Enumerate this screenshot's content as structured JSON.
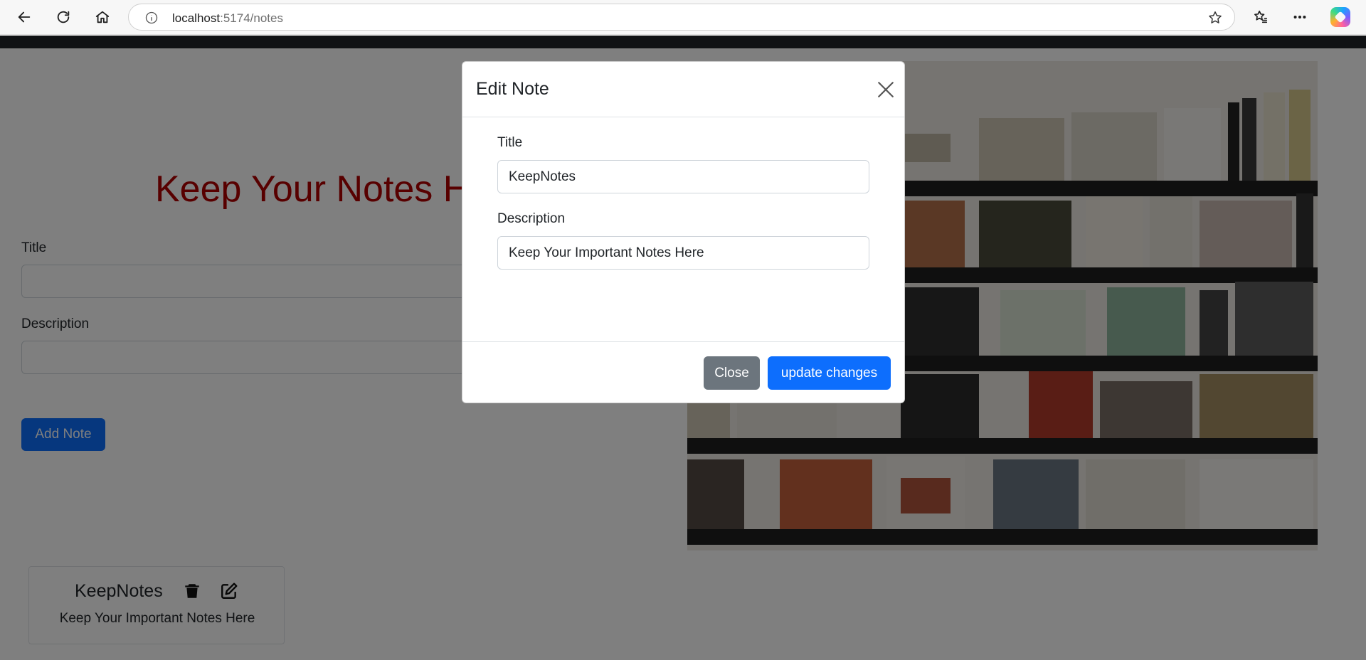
{
  "browser": {
    "url_host": "localhost",
    "url_rest": ":5174/notes"
  },
  "page": {
    "hero_title": "Keep Your Notes Here",
    "form": {
      "title_label": "Title",
      "description_label": "Description",
      "add_button_label": "Add Note"
    },
    "note": {
      "title": "KeepNotes",
      "description": "Keep Your Important Notes Here"
    }
  },
  "modal": {
    "title": "Edit Note",
    "title_label": "Title",
    "title_value": "KeepNotes",
    "description_label": "Description",
    "description_value": "Keep Your Important Notes Here",
    "close_button_label": "Close",
    "update_button_label": "update changes"
  },
  "colors": {
    "primary": "#0d6efd",
    "secondary": "#6c757d",
    "hero_title": "#b00000"
  },
  "icons": {
    "back": "arrow-left-icon",
    "refresh": "refresh-icon",
    "home": "home-icon",
    "info": "info-icon",
    "favorite": "star-icon",
    "favorites": "favorites-icon",
    "more": "more-icon",
    "copilot": "copilot-icon",
    "delete": "trash-icon",
    "edit": "edit-icon",
    "close": "close-icon"
  }
}
